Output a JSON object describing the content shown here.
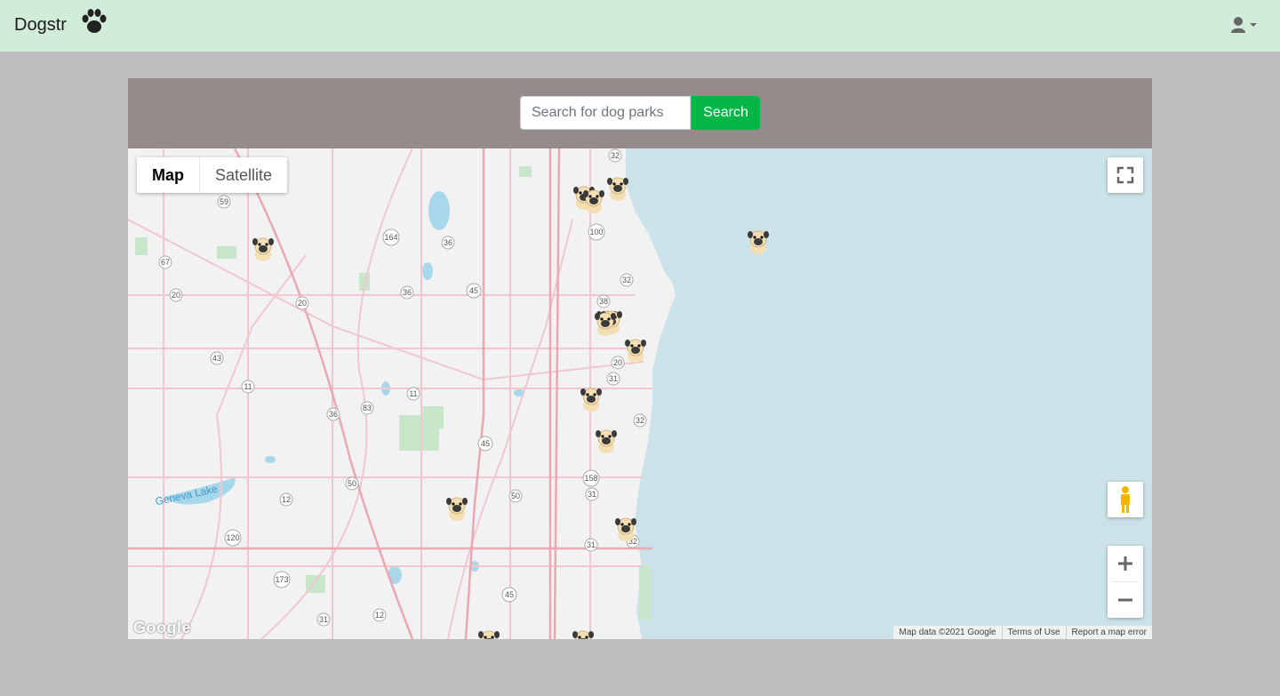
{
  "navbar": {
    "brand": "Dogstr",
    "paw_icon": "paw-icon",
    "user_icon": "user-icon"
  },
  "search": {
    "placeholder": "Search for dog parks",
    "value": "",
    "button_label": "Search"
  },
  "map": {
    "type_controls": [
      "Map",
      "Satellite"
    ],
    "active_type": "Map",
    "lake_label": "Geneva Lake",
    "attribution": {
      "map_data": "Map data ©2021 Google",
      "terms": "Terms of Use",
      "report": "Report a map error"
    },
    "logo": "Google",
    "pin_count": 15
  },
  "colors": {
    "navbar_bg": "#d2ecda",
    "search_bar_bg": "#958b8b",
    "search_button": "#04b646",
    "water": "#cbe3e8",
    "page_bg": "#bdbdbd"
  }
}
